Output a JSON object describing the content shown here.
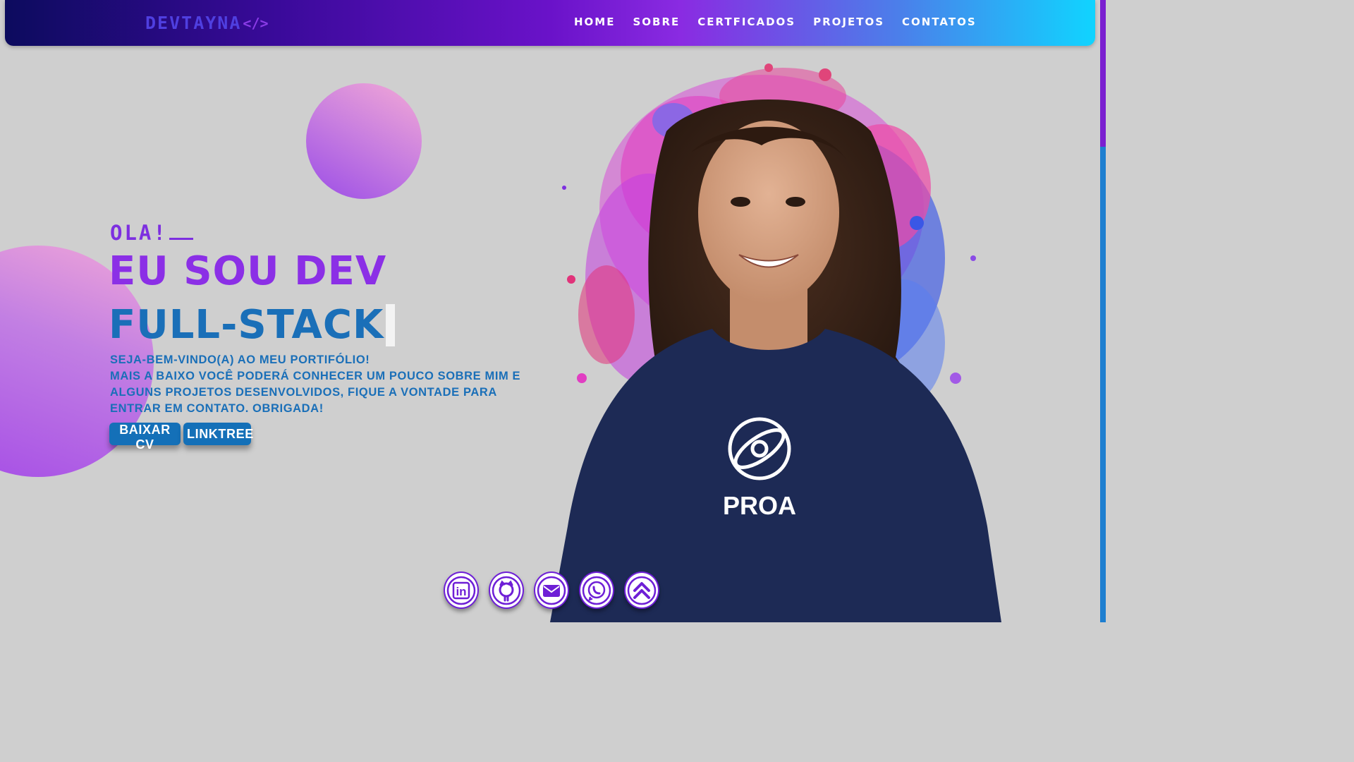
{
  "navbar": {
    "logo_text": "DEVTAYNA",
    "logo_tag": "</>",
    "links": [
      {
        "label": "HOME"
      },
      {
        "label": "SOBRE"
      },
      {
        "label": "CERTFICADOS"
      },
      {
        "label": "PROJETOS"
      },
      {
        "label": "CONTATOS"
      }
    ]
  },
  "hero": {
    "greeting": "OLA!",
    "headline_1": "EU SOU DEV",
    "headline_2": "FULL-STACK",
    "intro_lines": [
      "SEJA-BEM-VINDO(A) AO MEU PORTIFÓLIO!",
      "MAIS A BAIXO VOCÊ PODERÁ CONHECER UM POUCO SOBRE MIM E ALGUNS PROJETOS DESENVOLVIDOS, FIQUE A VONTADE PARA ENTRAR EM CONTATO. OBRIGADA!"
    ],
    "buttons": {
      "download_cv": "BAIXAR CV",
      "linktree": "LINKTREE"
    }
  },
  "portrait": {
    "shirt_text": "PROA"
  },
  "social": {
    "icons": [
      "linkedin-icon",
      "github-icon",
      "envelope-icon",
      "whatsapp-icon",
      "chevrons-up-icon"
    ],
    "linkedin_text": "in"
  },
  "colors": {
    "accent_purple": "#8b2fe6",
    "accent_blue": "#1a6fb8",
    "background": "#cfcfcf",
    "shirt_navy": "#1d2a55"
  }
}
